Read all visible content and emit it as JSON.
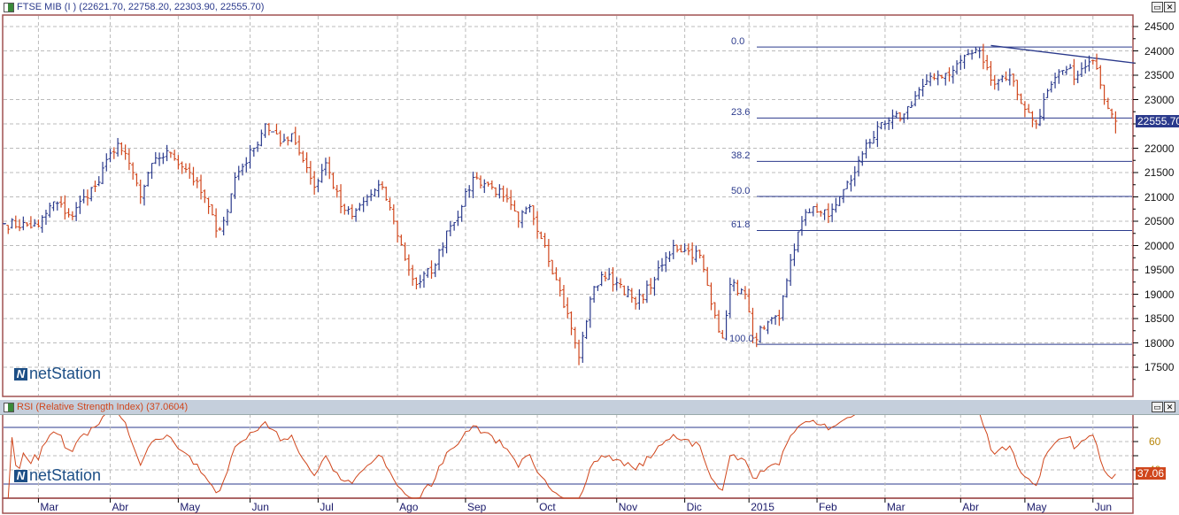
{
  "main_pane": {
    "title": "FTSE MIB (I ) (22621.70, 22758.20, 22303.90, 22555.70)",
    "last_price_label": "22555.70",
    "price_axis": [
      "24500",
      "24000",
      "23500",
      "23000",
      "22000",
      "21500",
      "21000",
      "20500",
      "20000",
      "19500",
      "19000",
      "18500",
      "18000",
      "17500"
    ],
    "fib_levels": [
      {
        "label": "0.0",
        "price": 24080
      },
      {
        "label": "23.6",
        "price": 22620
      },
      {
        "label": "38.2",
        "price": 21730
      },
      {
        "label": "50.0",
        "price": 21010
      },
      {
        "label": "61.8",
        "price": 20310
      },
      {
        "label": "100.0",
        "price": 17970
      }
    ],
    "trendline": {
      "from": {
        "day": 261,
        "price": 24110
      },
      "to": {
        "day": 299,
        "price": 23750
      }
    },
    "logo": "netStation"
  },
  "rsi_pane": {
    "title": "RSI (Relative Strength Index) (37.0604)",
    "value_label": "37.06",
    "axis": [
      "60",
      "40"
    ],
    "levels": [
      70,
      30
    ],
    "logo": "netStation"
  },
  "months": [
    {
      "label": "Mar",
      "day": 9
    },
    {
      "label": "Abr",
      "day": 28
    },
    {
      "label": "May",
      "day": 46
    },
    {
      "label": "Jun",
      "day": 65
    },
    {
      "label": "Jul",
      "day": 83
    },
    {
      "label": "Ago",
      "day": 104
    },
    {
      "label": "Sep",
      "day": 122
    },
    {
      "label": "Oct",
      "day": 141
    },
    {
      "label": "Nov",
      "day": 162
    },
    {
      "label": "Dic",
      "day": 180
    },
    {
      "label": "2015",
      "day": 197
    },
    {
      "label": "Feb",
      "day": 215
    },
    {
      "label": "Mar",
      "day": 233
    },
    {
      "label": "Abr",
      "day": 253
    },
    {
      "label": "May",
      "day": 270
    },
    {
      "label": "Jun",
      "day": 288
    }
  ],
  "colors": {
    "up": "#2b3a8c",
    "down": "#d0461c",
    "rsi": "#d0461c",
    "fib": "#2b3a8c",
    "frame": "#a05050"
  },
  "chart_data": {
    "type": "ohlc",
    "title": "FTSE MIB",
    "ylim": [
      17000,
      24800
    ],
    "close_anchors": [
      [
        0,
        20450
      ],
      [
        9,
        20400
      ],
      [
        13,
        20900
      ],
      [
        18,
        20600
      ],
      [
        21,
        21000
      ],
      [
        25,
        21300
      ],
      [
        28,
        21900
      ],
      [
        30,
        22100
      ],
      [
        34,
        21500
      ],
      [
        36,
        21000
      ],
      [
        40,
        21800
      ],
      [
        44,
        21900
      ],
      [
        49,
        21500
      ],
      [
        54,
        20800
      ],
      [
        56,
        20300
      ],
      [
        59,
        20700
      ],
      [
        61,
        21400
      ],
      [
        66,
        22000
      ],
      [
        69,
        22500
      ],
      [
        73,
        22100
      ],
      [
        76,
        22300
      ],
      [
        80,
        21600
      ],
      [
        82,
        21200
      ],
      [
        85,
        21700
      ],
      [
        89,
        20800
      ],
      [
        92,
        20600
      ],
      [
        96,
        21000
      ],
      [
        100,
        21200
      ],
      [
        103,
        20500
      ],
      [
        107,
        19500
      ],
      [
        109,
        19200
      ],
      [
        114,
        19600
      ],
      [
        117,
        20300
      ],
      [
        121,
        20800
      ],
      [
        124,
        21400
      ],
      [
        129,
        21200
      ],
      [
        132,
        21000
      ],
      [
        136,
        20500
      ],
      [
        139,
        20800
      ],
      [
        143,
        20000
      ],
      [
        146,
        19300
      ],
      [
        150,
        18300
      ],
      [
        152,
        17700
      ],
      [
        155,
        18900
      ],
      [
        158,
        19400
      ],
      [
        163,
        19200
      ],
      [
        167,
        18800
      ],
      [
        172,
        19300
      ],
      [
        177,
        20000
      ],
      [
        180,
        19900
      ],
      [
        184,
        19800
      ],
      [
        187,
        18800
      ],
      [
        190,
        18100
      ],
      [
        192,
        19200
      ],
      [
        196,
        19000
      ],
      [
        198,
        18100
      ],
      [
        201,
        18300
      ],
      [
        205,
        18500
      ],
      [
        208,
        19700
      ],
      [
        211,
        20500
      ],
      [
        214,
        20800
      ],
      [
        218,
        20600
      ],
      [
        221,
        21000
      ],
      [
        225,
        21500
      ],
      [
        228,
        22100
      ],
      [
        233,
        22500
      ],
      [
        238,
        22700
      ],
      [
        242,
        23200
      ],
      [
        247,
        23500
      ],
      [
        251,
        23600
      ],
      [
        254,
        23900
      ],
      [
        258,
        24000
      ],
      [
        261,
        23400
      ],
      [
        266,
        23500
      ],
      [
        270,
        22800
      ],
      [
        273,
        22500
      ],
      [
        275,
        23000
      ],
      [
        280,
        23600
      ],
      [
        284,
        23500
      ],
      [
        288,
        23800
      ],
      [
        290,
        23300
      ],
      [
        293,
        22700
      ],
      [
        294,
        22555.7
      ]
    ],
    "last_bar": {
      "open": 22621.7,
      "high": 22758.2,
      "low": 22303.9,
      "close": 22555.7
    },
    "rsi_period": 14,
    "rsi_last": 37.0604
  }
}
